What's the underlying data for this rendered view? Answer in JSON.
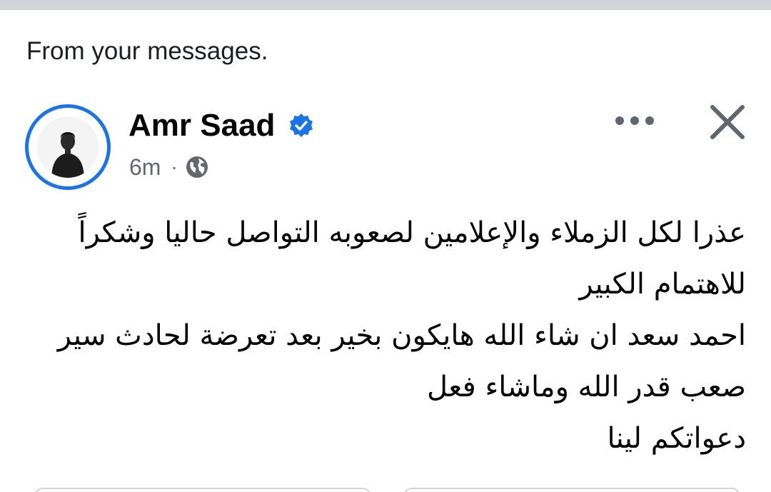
{
  "section": {
    "label": "From your messages."
  },
  "post": {
    "author": "Amr Saad",
    "verified": true,
    "time": "6m",
    "separator": "·",
    "privacy_icon": "globe-icon",
    "more_icon": "more-dots-icon",
    "close_icon": "close-icon",
    "body_lines": [
      "عذرا لكل الزملاء والإعلامين لصعوبه التواصل حاليا  وشكراً",
      "للاهتمام الكبير",
      "احمد سعد ان شاء الله هايكون بخير بعد تعرضة لحادث سير",
      "صعب قدر الله وماشاء فعل",
      "دعواتكم لينا"
    ]
  },
  "colors": {
    "accent": "#1b74e4",
    "secondary_text": "#65676b",
    "divider": "#d3d4d8"
  }
}
